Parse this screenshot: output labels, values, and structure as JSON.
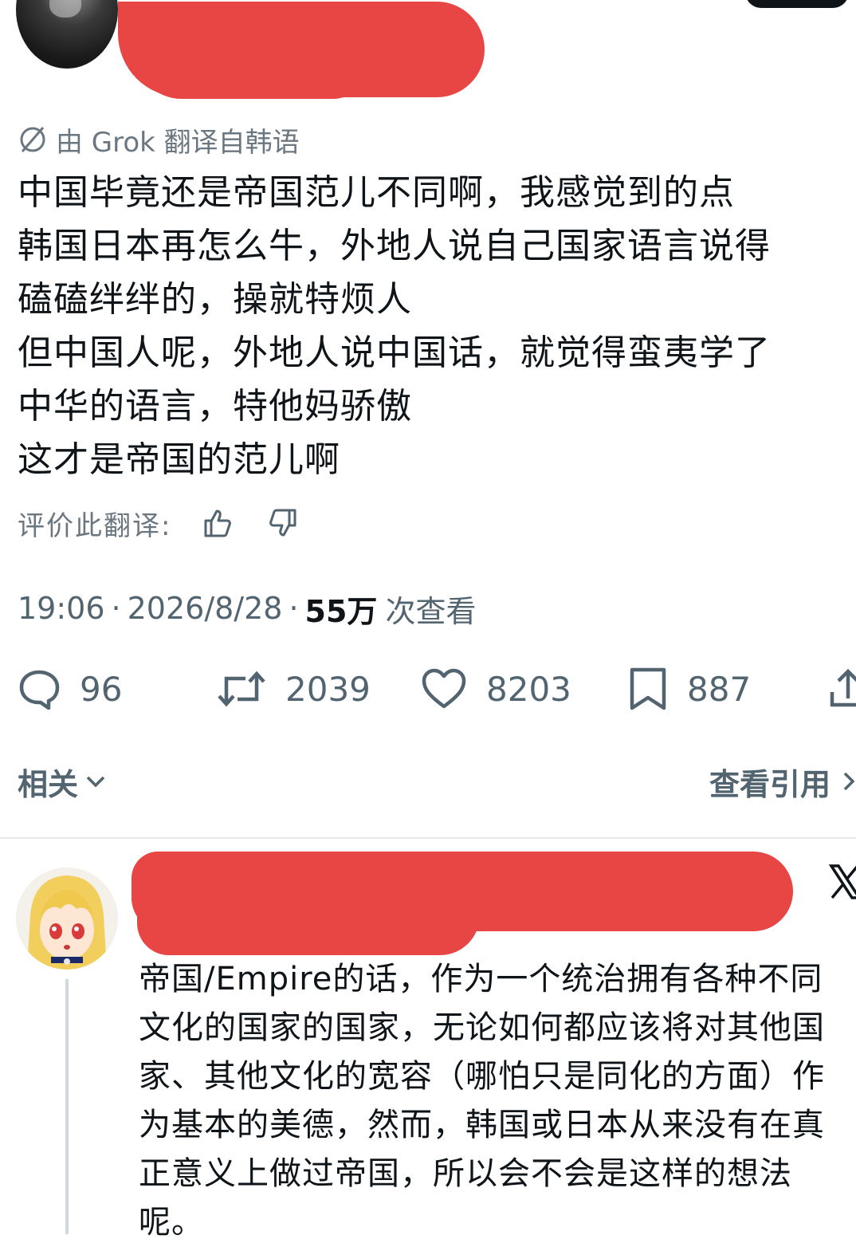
{
  "tweet": {
    "translation_note": "由 Grok 翻译自韩语",
    "text": "中国毕竟还是帝国范儿不同啊，我感觉到的点\n韩国日本再怎么牛，外地人说自己国家语言说得\n磕磕绊绊的，操就特烦人\n但中国人呢，外地人说中国话，就觉得蛮夷学了\n中华的语言，特他妈骄傲\n这才是帝国的范儿啊",
    "rate_label": "评价此翻译:",
    "time": "19:06",
    "date": "2026/8/28",
    "separator": "·",
    "views_count": "55万",
    "views_label": "次查看",
    "replies": "96",
    "reposts": "2039",
    "likes": "8203",
    "bookmarks": "887"
  },
  "related": {
    "label": "相关",
    "quotes_link": "查看引用"
  },
  "reply": {
    "text": "帝国/Empire的话，作为一个统治拥有各种不同\n文化的国家的国家，无论如何都应该将对其他国\n家、其他文化的宽容（哪怕只是同化的方面）作\n为基本的美德，然而，韩国或日本从来没有在真\n正意义上做过帝国，所以会不会是这样的想法\n呢。"
  },
  "colors": {
    "redaction": "#e84545",
    "secondary_text": "#536471",
    "primary_text": "#0f1419"
  },
  "icons": [
    "grok-icon",
    "thumbs-up-icon",
    "thumbs-down-icon",
    "reply-icon",
    "repost-icon",
    "like-icon",
    "bookmark-icon",
    "share-icon",
    "chevron-down-icon",
    "chevron-right-icon",
    "x-logo-icon"
  ]
}
